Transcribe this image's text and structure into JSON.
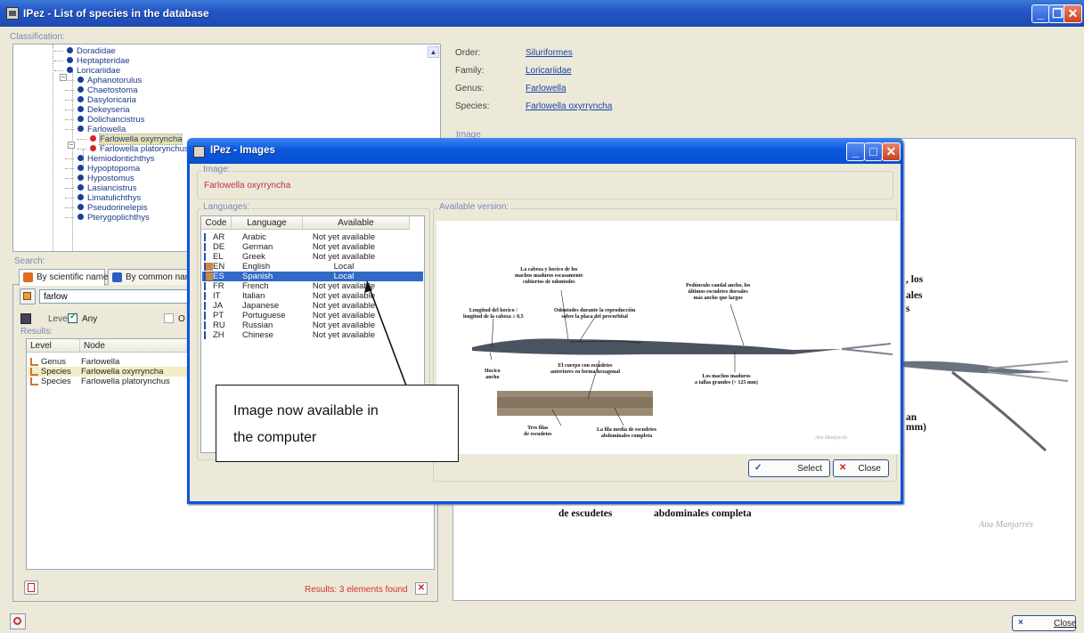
{
  "window": {
    "title": "IPez - List of species in the database"
  },
  "classification": {
    "label": "Classification:",
    "tree": [
      {
        "label": "Doradidae",
        "color": "blue"
      },
      {
        "label": "Heptapteridae",
        "color": "blue"
      },
      {
        "label": "Loricariidae",
        "color": "blue"
      },
      {
        "label": "Aphanotorulus",
        "color": "blue"
      },
      {
        "label": "Chaetostoma",
        "color": "blue"
      },
      {
        "label": "Dasyloricaria",
        "color": "blue"
      },
      {
        "label": "Dekeyseria",
        "color": "blue"
      },
      {
        "label": "Dolichancistrus",
        "color": "blue"
      },
      {
        "label": "Farlowella",
        "color": "blue"
      },
      {
        "label": "Farlowella oxyrryncha",
        "color": "red"
      },
      {
        "label": "Farlowella platorynchus",
        "color": "red"
      },
      {
        "label": "Hemiodontichthys",
        "color": "blue"
      },
      {
        "label": "Hypoptopoma",
        "color": "blue"
      },
      {
        "label": "Hypostomus",
        "color": "blue"
      },
      {
        "label": "Lasiancistrus",
        "color": "blue"
      },
      {
        "label": "Limatulichthys",
        "color": "blue"
      },
      {
        "label": "Pseudorinelepis",
        "color": "blue"
      },
      {
        "label": "Pterygoplichthys",
        "color": "blue"
      }
    ]
  },
  "info": {
    "order_label": "Order:",
    "order_value": "Siluriformes",
    "family_label": "Family:",
    "family_value": "Loricariidae",
    "genus_label": "Genus:",
    "genus_value": "Farlowella",
    "species_label": "Species:",
    "species_value": "Farlowella oxyrryncha",
    "image_label": "Image"
  },
  "search": {
    "label": "Search:",
    "tab_scientific": "By scientific name",
    "tab_common": "By common nam",
    "query": "farlow",
    "level_label": "Level:",
    "any_label": "Any",
    "other_label": "O",
    "results_label": "Results:",
    "col_level": "Level",
    "col_node": "Node",
    "results": [
      {
        "level": "Genus",
        "node": "Farlowella"
      },
      {
        "level": "Species",
        "node": "Farlowella oxyrryncha"
      },
      {
        "level": "Species",
        "node": "Farlowella platorynchus"
      }
    ],
    "found_text": "Results: 3 elements found"
  },
  "background_text": {
    "t1": ", los",
    "t2": "ales",
    "t3": "s",
    "t4": "an",
    "t5": "mm)",
    "t6": "de escudetes",
    "t7": "abdominales completa",
    "signature": "Ana Manjarrés"
  },
  "main_close_label": "Close",
  "dialog": {
    "title": "IPez - Images",
    "image_label": "Image:",
    "image_value": "Farlowella oxyrryncha",
    "languages_label": "Languages:",
    "available_label": "Available version:",
    "col_code": "Code",
    "col_language": "Language",
    "col_available": "Available",
    "languages": [
      {
        "code": "AR",
        "name": "Arabic",
        "available": "Not yet available",
        "selected": false
      },
      {
        "code": "DE",
        "name": "German",
        "available": "Not yet available",
        "selected": false
      },
      {
        "code": "EL",
        "name": "Greek",
        "available": "Not yet available",
        "selected": false
      },
      {
        "code": "EN",
        "name": "English",
        "available": "Local",
        "selected": false
      },
      {
        "code": "ES",
        "name": "Spanish",
        "available": "Local",
        "selected": true
      },
      {
        "code": "FR",
        "name": "French",
        "available": "Not yet available",
        "selected": false
      },
      {
        "code": "IT",
        "name": "Italian",
        "available": "Not yet available",
        "selected": false
      },
      {
        "code": "JA",
        "name": "Japanese",
        "available": "Not yet available",
        "selected": false
      },
      {
        "code": "PT",
        "name": "Portuguese",
        "available": "Not yet available",
        "selected": false
      },
      {
        "code": "RU",
        "name": "Russian",
        "available": "Not yet available",
        "selected": false
      },
      {
        "code": "ZH",
        "name": "Chinese",
        "available": "Not yet available",
        "selected": false
      }
    ],
    "select_label": "Select",
    "close_label": "Close",
    "figure": {
      "a1": "La cabeza y hocico de los",
      "a2": "machos maduros escasamente",
      "a3": "cubiertos de odontodes",
      "b1": "Pedúnculo caudal ancho, los",
      "b2": "últimos escudetes dorsales",
      "b3": "más ancho que largos",
      "c1": "Longitud del hocico /",
      "c2": "longitud de la cabeza ≥ 0,5",
      "d1": "Odontodes  durante la reproducción",
      "d2": "sobre la placa del precorbital",
      "e1": "El cuerpo con escudetes",
      "e2": "anteriores en forma hexagonal",
      "f1": "Hocico",
      "f2": "ancho",
      "g1": "Los machos maduros",
      "g2": "a tallas grandes (> 125 mm)",
      "h1": "Tres filas",
      "h2": "de escudetes",
      "i1": "La fila media de escudetes",
      "i2": "abdominales completa",
      "sig": "Ana Manjarrés"
    }
  },
  "annotation": {
    "line1": "Image now available in",
    "line2": "the computer"
  },
  "colors": {
    "titlebar": "#2456c6",
    "selection": "#316ac5",
    "link": "#1a44a8",
    "accent_red": "#d22222"
  }
}
